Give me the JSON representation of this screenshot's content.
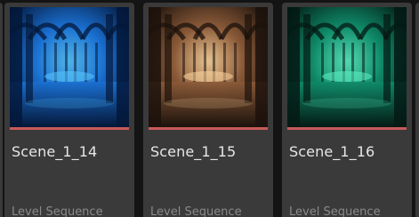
{
  "assets": [
    {
      "name": "Scene_1_14",
      "type": "Level Sequence",
      "thumbnail_tint": "#1a6fd0",
      "thumbnail_dark": "#04183a",
      "thumbnail_light": "#58c6ff"
    },
    {
      "name": "Scene_1_15",
      "type": "Level Sequence",
      "thumbnail_tint": "#8a5a38",
      "thumbnail_dark": "#1c120c",
      "thumbnail_light": "#ffd7a0"
    },
    {
      "name": "Scene_1_16",
      "type": "Level Sequence",
      "thumbnail_tint": "#0f8a68",
      "thumbnail_dark": "#041a14",
      "thumbnail_light": "#5cf0c4"
    }
  ],
  "colors": {
    "background": "#141414",
    "tile": "#3a3a3a",
    "asset_type_bar": "#c85a5a",
    "name_text": "#e6e6e6",
    "type_text": "#8a8a8a"
  }
}
